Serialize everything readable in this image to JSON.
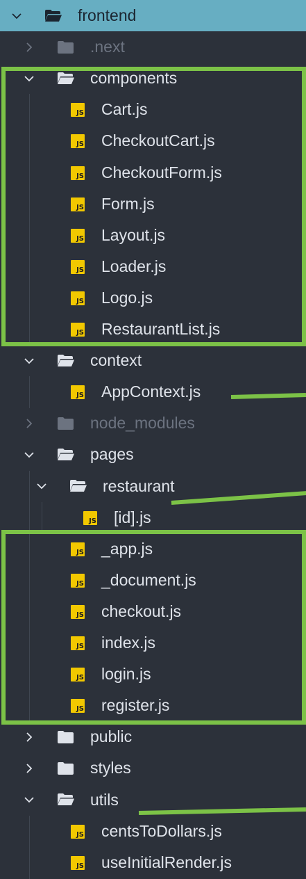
{
  "colors": {
    "background": "#2c313a",
    "selected_row": "#67aec2",
    "text": "#dfe3ea",
    "dim_text": "#6c7380",
    "js_badge": "#f2c800",
    "annotation": "#7cc247"
  },
  "explorer": {
    "items": [
      {
        "label": "frontend",
        "type": "folder",
        "expanded": true,
        "depth": 0,
        "selected": true,
        "dim": false,
        "icon": "folder-open-icon"
      },
      {
        "label": ".next",
        "type": "folder",
        "expanded": false,
        "depth": 1,
        "selected": false,
        "dim": true,
        "icon": "folder-icon"
      },
      {
        "label": "components",
        "type": "folder",
        "expanded": true,
        "depth": 1,
        "selected": false,
        "dim": false,
        "icon": "folder-open-icon"
      },
      {
        "label": "Cart.js",
        "type": "file",
        "depth": 2,
        "selected": false,
        "dim": false,
        "icon": "js-file-icon"
      },
      {
        "label": "CheckoutCart.js",
        "type": "file",
        "depth": 2,
        "selected": false,
        "dim": false,
        "icon": "js-file-icon"
      },
      {
        "label": "CheckoutForm.js",
        "type": "file",
        "depth": 2,
        "selected": false,
        "dim": false,
        "icon": "js-file-icon"
      },
      {
        "label": "Form.js",
        "type": "file",
        "depth": 2,
        "selected": false,
        "dim": false,
        "icon": "js-file-icon"
      },
      {
        "label": "Layout.js",
        "type": "file",
        "depth": 2,
        "selected": false,
        "dim": false,
        "icon": "js-file-icon"
      },
      {
        "label": "Loader.js",
        "type": "file",
        "depth": 2,
        "selected": false,
        "dim": false,
        "icon": "js-file-icon"
      },
      {
        "label": "Logo.js",
        "type": "file",
        "depth": 2,
        "selected": false,
        "dim": false,
        "icon": "js-file-icon"
      },
      {
        "label": "RestaurantList.js",
        "type": "file",
        "depth": 2,
        "selected": false,
        "dim": false,
        "icon": "js-file-icon"
      },
      {
        "label": "context",
        "type": "folder",
        "expanded": true,
        "depth": 1,
        "selected": false,
        "dim": false,
        "icon": "folder-open-icon"
      },
      {
        "label": "AppContext.js",
        "type": "file",
        "depth": 2,
        "selected": false,
        "dim": false,
        "icon": "js-file-icon"
      },
      {
        "label": "node_modules",
        "type": "folder",
        "expanded": false,
        "depth": 1,
        "selected": false,
        "dim": true,
        "icon": "folder-icon"
      },
      {
        "label": "pages",
        "type": "folder",
        "expanded": true,
        "depth": 1,
        "selected": false,
        "dim": false,
        "icon": "folder-open-icon"
      },
      {
        "label": "restaurant",
        "type": "folder",
        "expanded": true,
        "depth": 2,
        "selected": false,
        "dim": false,
        "icon": "folder-open-icon"
      },
      {
        "label": "[id].js",
        "type": "file",
        "depth": 3,
        "selected": false,
        "dim": false,
        "icon": "js-file-icon"
      },
      {
        "label": "_app.js",
        "type": "file",
        "depth": 2,
        "selected": false,
        "dim": false,
        "icon": "js-file-icon"
      },
      {
        "label": "_document.js",
        "type": "file",
        "depth": 2,
        "selected": false,
        "dim": false,
        "icon": "js-file-icon"
      },
      {
        "label": "checkout.js",
        "type": "file",
        "depth": 2,
        "selected": false,
        "dim": false,
        "icon": "js-file-icon"
      },
      {
        "label": "index.js",
        "type": "file",
        "depth": 2,
        "selected": false,
        "dim": false,
        "icon": "js-file-icon"
      },
      {
        "label": "login.js",
        "type": "file",
        "depth": 2,
        "selected": false,
        "dim": false,
        "icon": "js-file-icon"
      },
      {
        "label": "register.js",
        "type": "file",
        "depth": 2,
        "selected": false,
        "dim": false,
        "icon": "js-file-icon"
      },
      {
        "label": "public",
        "type": "folder",
        "expanded": false,
        "depth": 1,
        "selected": false,
        "dim": false,
        "icon": "folder-icon"
      },
      {
        "label": "styles",
        "type": "folder",
        "expanded": false,
        "depth": 1,
        "selected": false,
        "dim": false,
        "icon": "folder-icon"
      },
      {
        "label": "utils",
        "type": "folder",
        "expanded": true,
        "depth": 1,
        "selected": false,
        "dim": false,
        "icon": "folder-open-icon"
      },
      {
        "label": "centsToDollars.js",
        "type": "file",
        "depth": 2,
        "selected": false,
        "dim": false,
        "icon": "js-file-icon"
      },
      {
        "label": "useInitialRender.js",
        "type": "file",
        "depth": 2,
        "selected": false,
        "dim": false,
        "icon": "js-file-icon"
      }
    ]
  },
  "file_badge_text": "JS"
}
